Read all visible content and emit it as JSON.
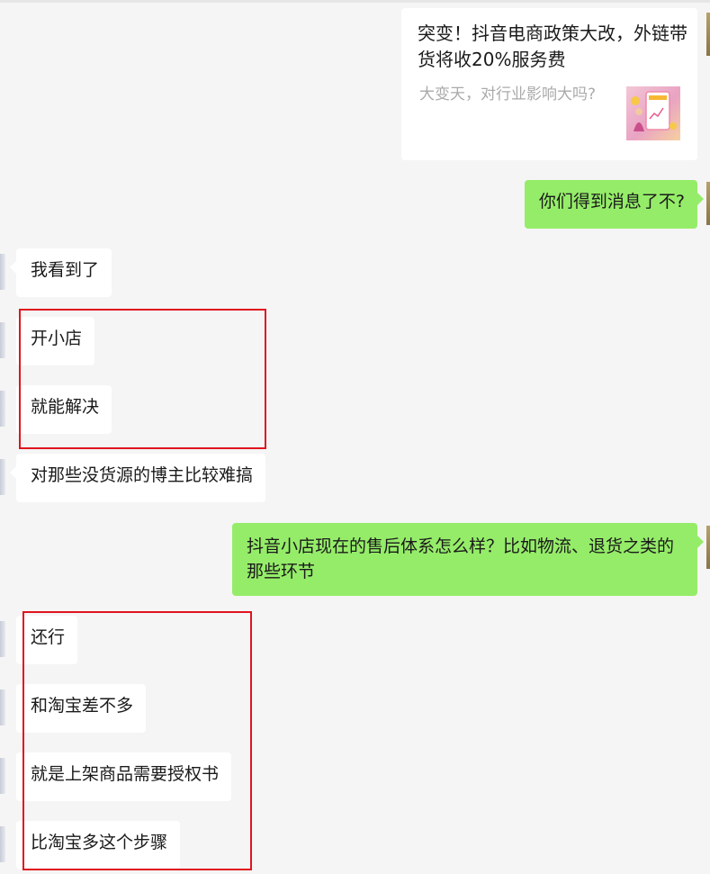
{
  "card": {
    "title": "突变！抖音电商政策大改，外链带货将收20%服务费",
    "description": "大变天，对行业影响大吗?",
    "thumbnail_icon": "phone-shopping-thumbnail"
  },
  "messages": [
    {
      "side": "right",
      "text": "你们得到消息了不?"
    },
    {
      "side": "left",
      "text": "我看到了"
    },
    {
      "side": "left",
      "text": "开小店"
    },
    {
      "side": "left",
      "text": "就能解决"
    },
    {
      "side": "left",
      "text": "对那些没货源的博主比较难搞"
    },
    {
      "side": "right",
      "text": "抖音小店现在的售后体系怎么样？比如物流、退货之类的那些环节"
    },
    {
      "side": "left",
      "text": "还行"
    },
    {
      "side": "left",
      "text": "和淘宝差不多"
    },
    {
      "side": "left",
      "text": "就是上架商品需要授权书"
    },
    {
      "side": "left",
      "text": "比淘宝多这个步骤"
    }
  ],
  "colors": {
    "background": "#f5f5f5",
    "bubble_self": "#95ec69",
    "bubble_other": "#ffffff",
    "highlight_box": "#e0141e"
  }
}
